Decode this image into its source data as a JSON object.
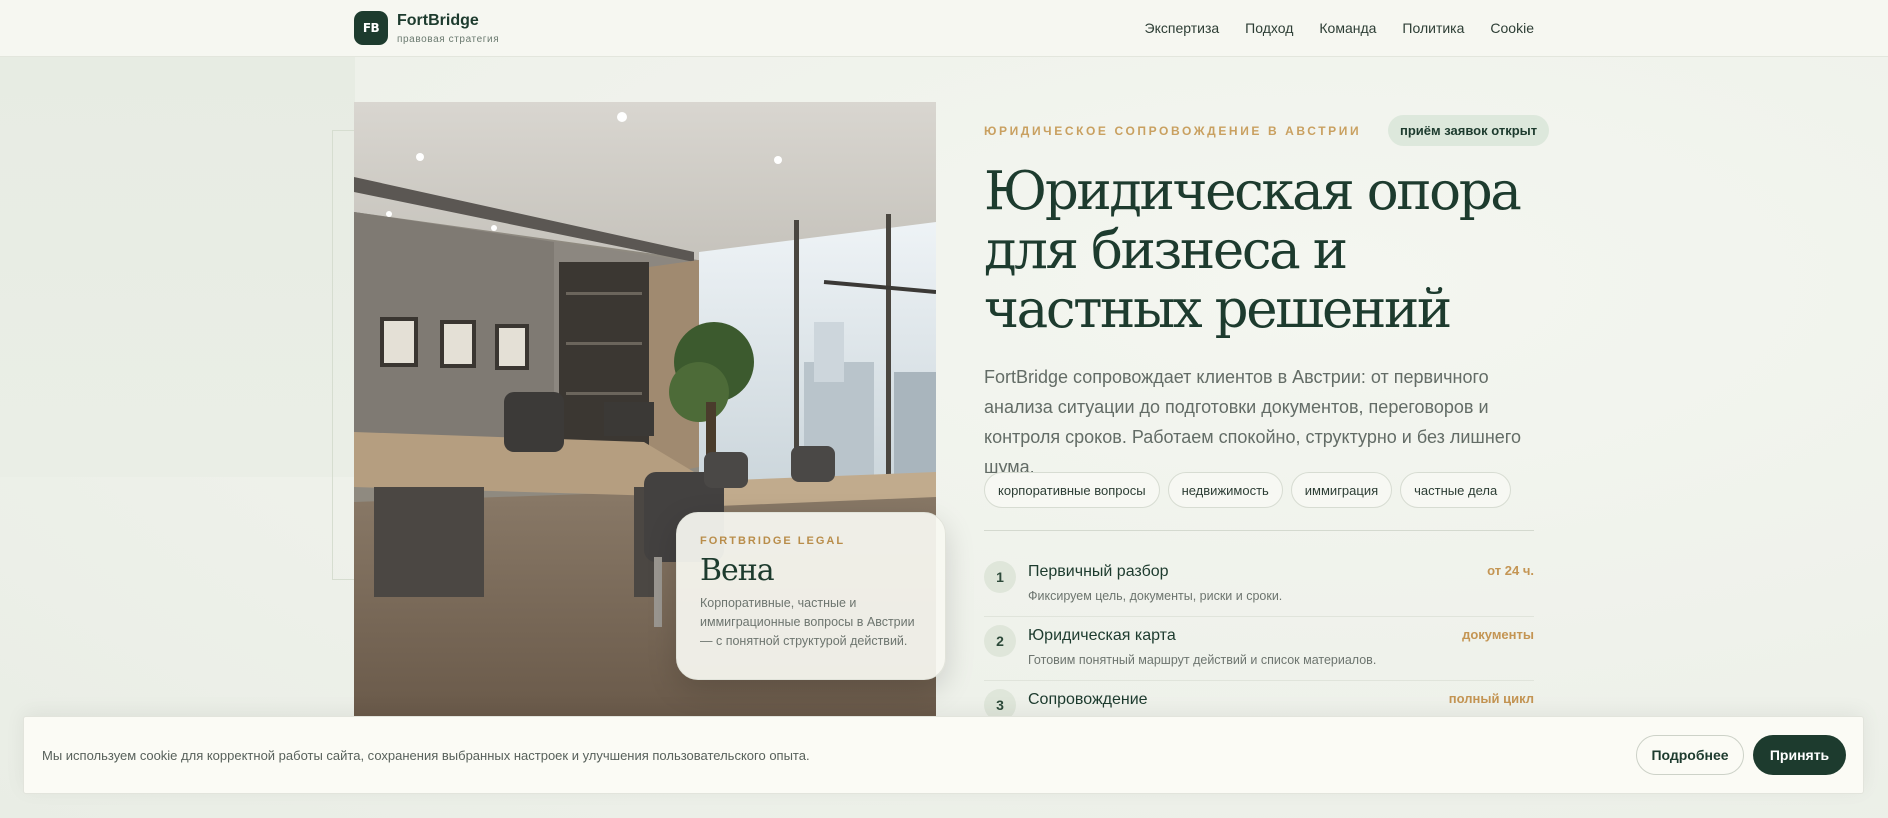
{
  "header": {
    "logo_mark": "FB",
    "brand_name": "FortBridge",
    "brand_tagline": "правовая стратегия",
    "nav": [
      "Экспертиза",
      "Подход",
      "Команда",
      "Политика",
      "Cookie"
    ]
  },
  "card": {
    "kicker": "FORTBRIDGE LEGAL",
    "city": "Вена",
    "text": "Корпоративные, частные и иммиграционные вопросы в Австрии — с понятной структурой действий."
  },
  "hero": {
    "kicker": "ЮРИДИЧЕСКОЕ СОПРОВОЖДЕНИЕ В АВСТРИИ",
    "badge": "приём заявок открыт",
    "title_line1": "Юридическая опора",
    "title_line2": "для бизнеса и",
    "title_line3": "частных решений",
    "lead": "FortBridge сопровождает клиентов в Австрии: от первичного анализа ситуации до подготовки документов, переговоров и контроля сроков. Работаем спокойно, структурно и без лишнего шума.",
    "chips": [
      "корпоративные вопросы",
      "недвижимость",
      "иммиграция",
      "частные дела"
    ]
  },
  "steps": [
    {
      "num": "1",
      "title": "Первичный разбор",
      "desc": "Фиксируем цель, документы, риски и сроки.",
      "meta": "от 24 ч."
    },
    {
      "num": "2",
      "title": "Юридическая карта",
      "desc": "Готовим понятный маршрут действий и список материалов.",
      "meta": "документы"
    },
    {
      "num": "3",
      "title": "Сопровождение",
      "desc": "",
      "meta": "полный цикл"
    }
  ],
  "cookie": {
    "text": "Мы используем cookie для корректной работы сайта, сохранения выбранных настроек и улучшения пользовательского опыта.",
    "more_label": "Подробнее",
    "accept_label": "Принять"
  },
  "colors": {
    "brand": "#1d3b2e",
    "accent_gold": "#c49553",
    "background": "#eef1ea"
  }
}
